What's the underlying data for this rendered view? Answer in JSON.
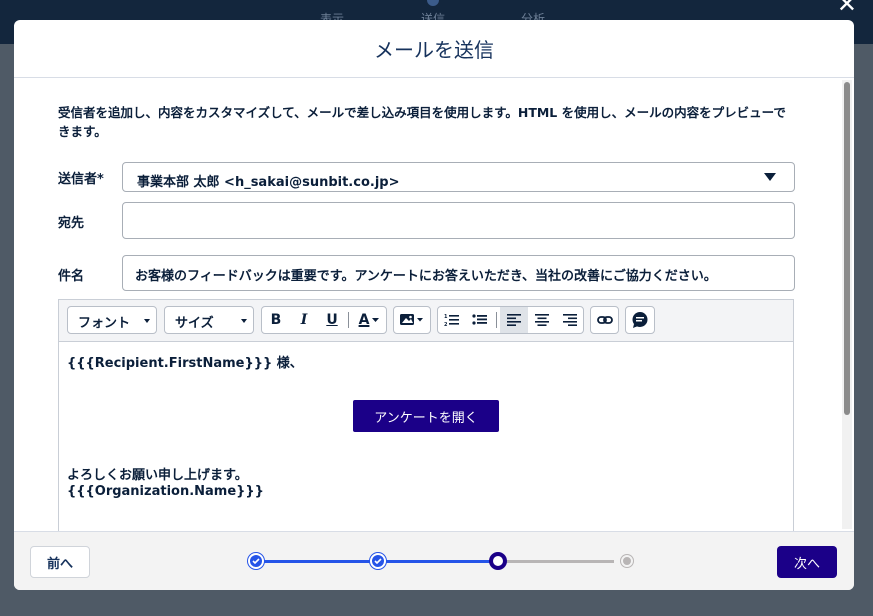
{
  "background": {
    "tabs": [
      {
        "label": "表示"
      },
      {
        "label": "送信"
      },
      {
        "label": "分析"
      }
    ],
    "close_symbol": "✕"
  },
  "modal": {
    "title": "メールを送信",
    "intro": "受信者を追加し、内容をカスタマイズして、メールで差し込み項目を使用します。HTML を使用し、メールの内容をプレビューできます。",
    "from": {
      "label": "送信者*",
      "value": "事業本部 太郎 <h_sakai@sunbit.co.jp>"
    },
    "to": {
      "label": "宛先",
      "value": ""
    },
    "subject": {
      "label": "件名",
      "value": "お客様のフィードバックは重要です。アンケートにお答えいただき、当社の改善にご協力ください。"
    },
    "toolbar": {
      "font_label": "フォント",
      "size_label": "サイズ",
      "bold": "B",
      "italic": "I",
      "underline": "U",
      "text_color": "A"
    },
    "body": {
      "greeting": "{{{Recipient.FirstName}}} 様、",
      "survey_button": "アンケートを開く",
      "regards": "よろしくお願い申し上げます。",
      "organization": "{{{Organization.Name}}}"
    }
  },
  "footer": {
    "prev_label": "前へ",
    "next_label": "次へ",
    "steps_total": 4,
    "current_step": 3
  },
  "colors": {
    "primary": "#1b0088",
    "progress_done": "#2554e8",
    "progress_todo": "#b8b5b5",
    "backdrop": "#4f5a66"
  }
}
